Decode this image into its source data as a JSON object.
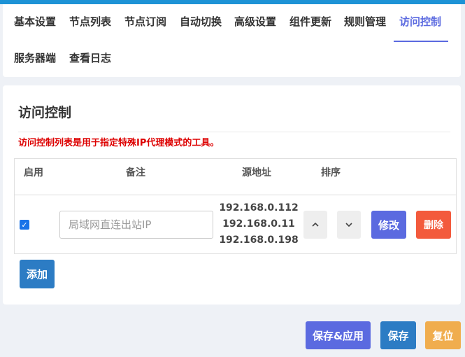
{
  "tabs": [
    {
      "label": "基本设置",
      "active": false
    },
    {
      "label": "节点列表",
      "active": false
    },
    {
      "label": "节点订阅",
      "active": false
    },
    {
      "label": "自动切换",
      "active": false
    },
    {
      "label": "高级设置",
      "active": false
    },
    {
      "label": "组件更新",
      "active": false
    },
    {
      "label": "规则管理",
      "active": false
    },
    {
      "label": "访问控制",
      "active": true
    },
    {
      "label": "服务器端",
      "active": false
    },
    {
      "label": "查看日志",
      "active": false
    }
  ],
  "section": {
    "title": "访问控制",
    "description": "访问控制列表是用于指定特殊IP代理模式的工具。"
  },
  "table": {
    "headers": {
      "enable": "启用",
      "remark": "备注",
      "source": "源地址",
      "sort": "排序"
    },
    "rows": [
      {
        "enabled": true,
        "remark_placeholder": "局域网直连出站IP",
        "sources": [
          "192.168.0.112",
          "192.168.0.11",
          "192.168.0.198"
        ],
        "edit_label": "修改",
        "delete_label": "删除"
      }
    ]
  },
  "actions": {
    "add_label": "添加",
    "save_apply_label": "保存&应用",
    "save_label": "保存",
    "reset_label": "复位"
  },
  "colors": {
    "accent": "#5b6ae0",
    "primary": "#2c7cc4",
    "danger": "#f35a3c",
    "warning": "#f0ad4e",
    "description": "#dd0000"
  }
}
